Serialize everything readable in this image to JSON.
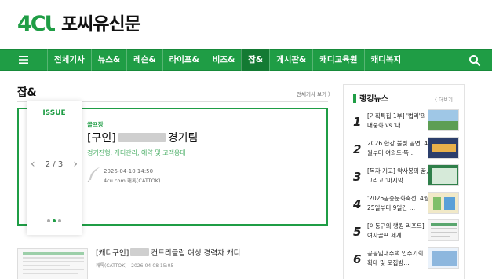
{
  "site": {
    "name": "포씨유신문",
    "logo_mark": "4CU"
  },
  "nav": {
    "items": [
      "전체기사",
      "뉴스&",
      "레슨&",
      "라이프&",
      "비즈&",
      "잡&",
      "게시판&",
      "캐디교육원",
      "캐디복지"
    ],
    "active_index": 5
  },
  "section": {
    "title": "잡&",
    "more": "전체기사 보기 〉"
  },
  "featured": {
    "issue_label": "ISSUE",
    "counter": "2 / 3",
    "category": "골프장",
    "title_prefix": "[구인]",
    "title_suffix": "경기팀",
    "subtitle": "경기진행, 캐디관리, 예약 및 고객응대",
    "date": "2026-04-10 14:50",
    "source": "4cu.com  캐톡(CATTOK)"
  },
  "list": [
    {
      "title_prefix": "[캐디구인]",
      "title_suffix": "컨트리클럽 여성 경력자 캐디",
      "meta": "캐톡(CATTOK)  ·  2026-04-08 15:05"
    }
  ],
  "ranking": {
    "title": "랭킹뉴스",
    "more": "더보기",
    "items": [
      {
        "num": "1",
        "text": "[기획특집 1부] '법리'의 대중화 vs '대…"
      },
      {
        "num": "2",
        "text": "2026 한강 불빛 공연, 4월부터 여의도·뚝…"
      },
      {
        "num": "3",
        "text": "[독자 기고] 약사봉의 꿈, 그리고 '마지막 …"
      },
      {
        "num": "4",
        "text": "'2026공중문화축전' 4월 25일부터 9일간 …"
      },
      {
        "num": "5",
        "text": "[이동규의 랭킹 리포트] 여자골프 세계…"
      },
      {
        "num": "6",
        "text": "공공임대주택 입주기회 확대 및 모집방…"
      }
    ]
  },
  "colors": {
    "brand": "#1f9d45"
  }
}
